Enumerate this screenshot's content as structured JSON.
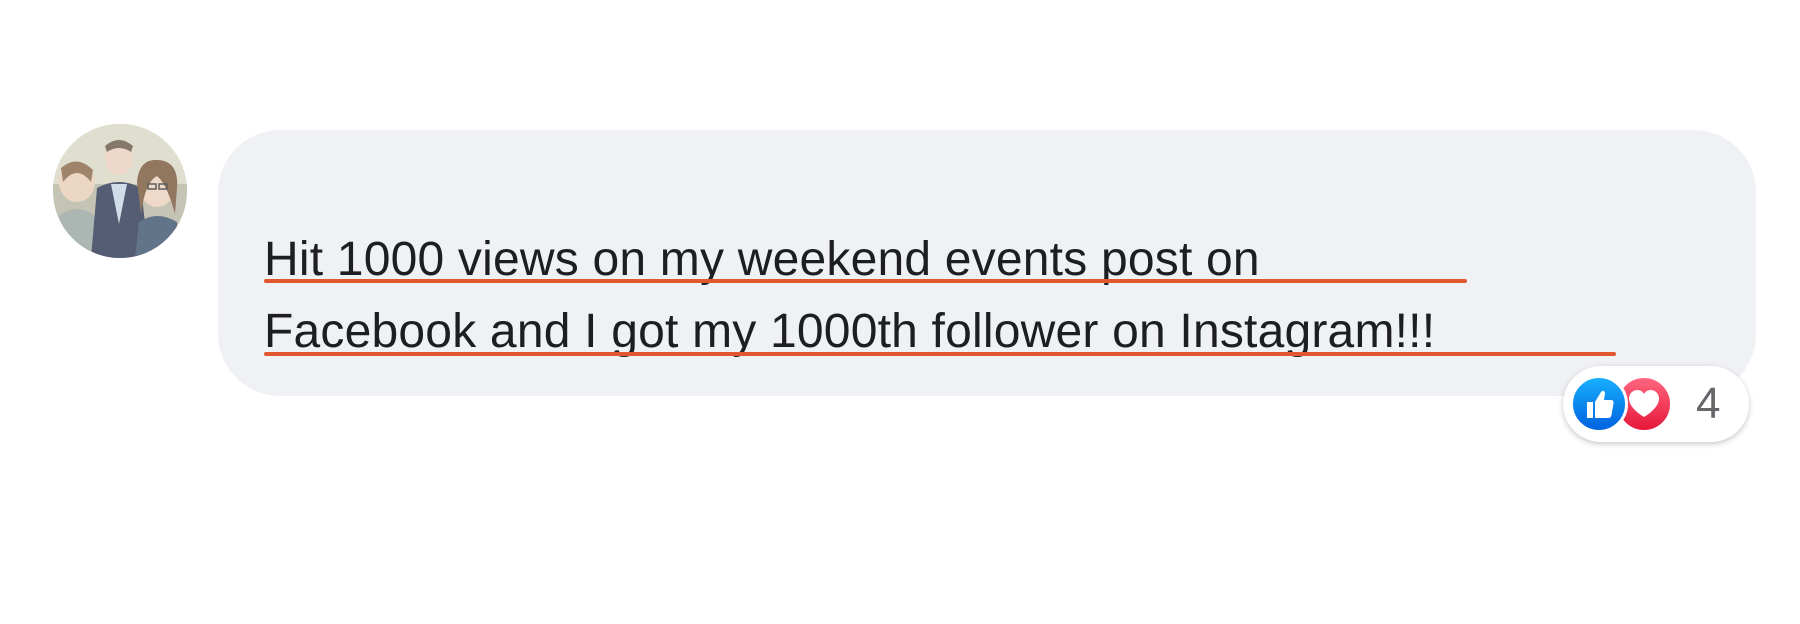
{
  "comment": {
    "lines": [
      "Hit 1000 views on my weekend events post on",
      "Facebook and I got my 1000th follower on Instagram!!!"
    ]
  },
  "reactions": {
    "count": "4",
    "icons": [
      "like-icon",
      "love-icon"
    ]
  },
  "colors": {
    "bubble": "#f0f1f5",
    "text": "#1c1e21",
    "underline": "#e2572d",
    "like": "#1877f2",
    "love": "#f33e58",
    "count": "#65676b"
  }
}
